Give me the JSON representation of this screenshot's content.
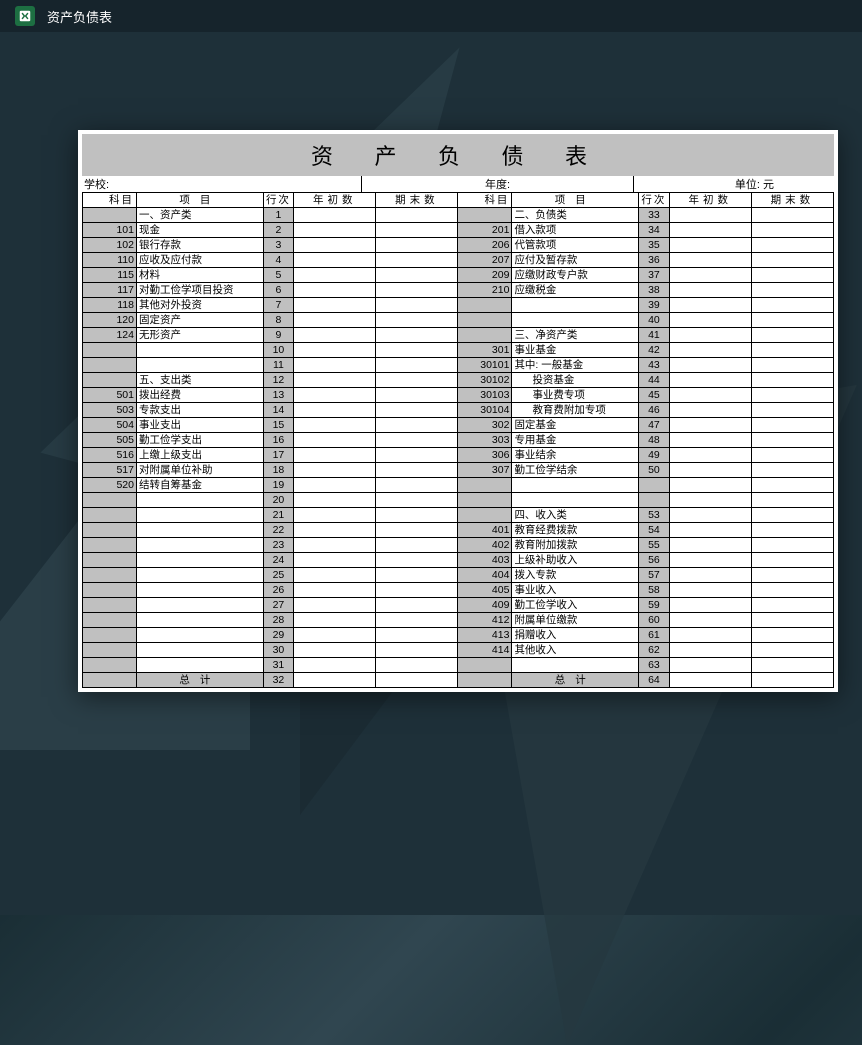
{
  "header": {
    "title": "资产负债表"
  },
  "sheet": {
    "title": "资 产 负 债 表",
    "meta": {
      "school_label": "学校:",
      "year_label": "年度:",
      "unit_label": "单位: 元"
    },
    "cols": {
      "km": "科目",
      "xm": "项目",
      "hc": "行次",
      "ncs": "年初数",
      "qms": "期末数"
    },
    "total_label": "总计",
    "rows": [
      {
        "lkm": "",
        "lxm": "一、资产类",
        "lhc": "1",
        "rkm": "",
        "rxm": "二、负债类",
        "rhc": "33"
      },
      {
        "lkm": "101",
        "lxm": "现金",
        "lhc": "2",
        "rkm": "201",
        "rxm": "借入款项",
        "rhc": "34"
      },
      {
        "lkm": "102",
        "lxm": "银行存款",
        "lhc": "3",
        "rkm": "206",
        "rxm": "代管款项",
        "rhc": "35"
      },
      {
        "lkm": "110",
        "lxm": "应收及应付款",
        "lhc": "4",
        "rkm": "207",
        "rxm": "应付及暂存款",
        "rhc": "36"
      },
      {
        "lkm": "115",
        "lxm": "材料",
        "lhc": "5",
        "rkm": "209",
        "rxm": "应缴财政专户款",
        "rhc": "37"
      },
      {
        "lkm": "117",
        "lxm": "对勤工俭学项目投资",
        "lhc": "6",
        "rkm": "210",
        "rxm": "应缴税金",
        "rhc": "38"
      },
      {
        "lkm": "118",
        "lxm": "其他对外投资",
        "lhc": "7",
        "rkm": "",
        "rxm": "",
        "rhc": "39"
      },
      {
        "lkm": "120",
        "lxm": "固定资产",
        "lhc": "8",
        "rkm": "",
        "rxm": "",
        "rhc": "40"
      },
      {
        "lkm": "124",
        "lxm": "无形资产",
        "lhc": "9",
        "rkm": "",
        "rxm": "三、净资产类",
        "rhc": "41"
      },
      {
        "lkm": "",
        "lxm": "",
        "lhc": "10",
        "rkm": "301",
        "rxm": "事业基金",
        "rhc": "42"
      },
      {
        "lkm": "",
        "lxm": "",
        "lhc": "11",
        "rkm": "30101",
        "rxm": "其中: 一般基金",
        "rhc": "43"
      },
      {
        "lkm": "",
        "lxm": "五、支出类",
        "lhc": "12",
        "rkm": "30102",
        "rxm": "投资基金",
        "rhc": "44",
        "rindent": true
      },
      {
        "lkm": "501",
        "lxm": "拨出经费",
        "lhc": "13",
        "rkm": "30103",
        "rxm": "事业费专项",
        "rhc": "45",
        "rindent": true
      },
      {
        "lkm": "503",
        "lxm": "专款支出",
        "lhc": "14",
        "rkm": "30104",
        "rxm": "教育费附加专项",
        "rhc": "46",
        "rindent": true
      },
      {
        "lkm": "504",
        "lxm": "事业支出",
        "lhc": "15",
        "rkm": "302",
        "rxm": "固定基金",
        "rhc": "47"
      },
      {
        "lkm": "505",
        "lxm": "勤工俭学支出",
        "lhc": "16",
        "rkm": "303",
        "rxm": "专用基金",
        "rhc": "48"
      },
      {
        "lkm": "516",
        "lxm": "上缴上级支出",
        "lhc": "17",
        "rkm": "306",
        "rxm": "事业结余",
        "rhc": "49"
      },
      {
        "lkm": "517",
        "lxm": "对附属单位补助",
        "lhc": "18",
        "rkm": "307",
        "rxm": "勤工俭学结余",
        "rhc": "50"
      },
      {
        "lkm": "520",
        "lxm": "结转自筹基金",
        "lhc": "19",
        "rkm": "",
        "rxm": "",
        "rhc": ""
      },
      {
        "lkm": "",
        "lxm": "",
        "lhc": "20",
        "rkm": "",
        "rxm": "",
        "rhc": ""
      },
      {
        "lkm": "",
        "lxm": "",
        "lhc": "21",
        "rkm": "",
        "rxm": "四、收入类",
        "rhc": "53"
      },
      {
        "lkm": "",
        "lxm": "",
        "lhc": "22",
        "rkm": "401",
        "rxm": "教育经费拨款",
        "rhc": "54"
      },
      {
        "lkm": "",
        "lxm": "",
        "lhc": "23",
        "rkm": "402",
        "rxm": "教育附加拨款",
        "rhc": "55"
      },
      {
        "lkm": "",
        "lxm": "",
        "lhc": "24",
        "rkm": "403",
        "rxm": "上级补助收入",
        "rhc": "56"
      },
      {
        "lkm": "",
        "lxm": "",
        "lhc": "25",
        "rkm": "404",
        "rxm": "拨入专款",
        "rhc": "57"
      },
      {
        "lkm": "",
        "lxm": "",
        "lhc": "26",
        "rkm": "405",
        "rxm": "事业收入",
        "rhc": "58"
      },
      {
        "lkm": "",
        "lxm": "",
        "lhc": "27",
        "rkm": "409",
        "rxm": "勤工俭学收入",
        "rhc": "59"
      },
      {
        "lkm": "",
        "lxm": "",
        "lhc": "28",
        "rkm": "412",
        "rxm": "附属单位缴款",
        "rhc": "60"
      },
      {
        "lkm": "",
        "lxm": "",
        "lhc": "29",
        "rkm": "413",
        "rxm": "捐赠收入",
        "rhc": "61"
      },
      {
        "lkm": "",
        "lxm": "",
        "lhc": "30",
        "rkm": "414",
        "rxm": "其他收入",
        "rhc": "62"
      },
      {
        "lkm": "",
        "lxm": "",
        "lhc": "31",
        "rkm": "",
        "rxm": "",
        "rhc": "63"
      }
    ],
    "total_row": {
      "lhc": "32",
      "rhc": "64"
    }
  }
}
